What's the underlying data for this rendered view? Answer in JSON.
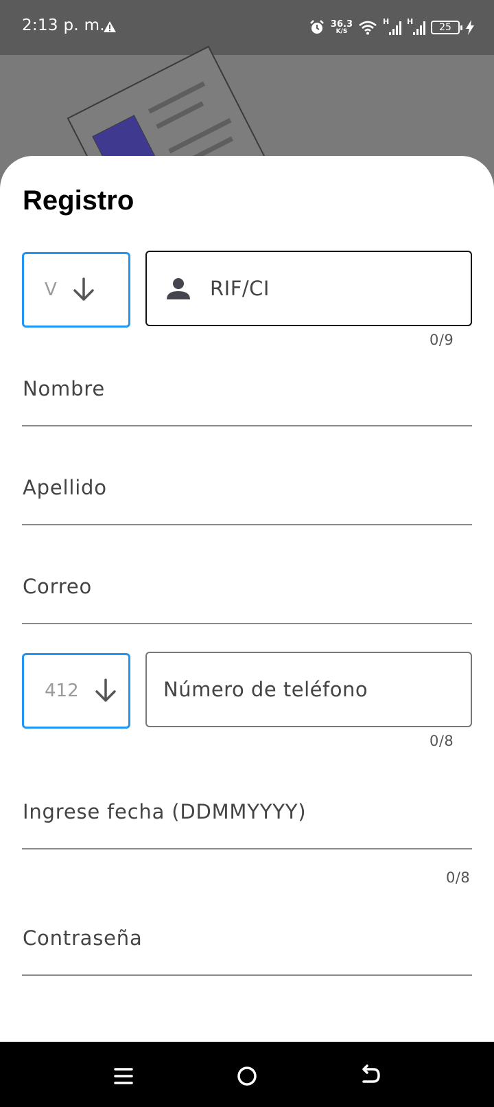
{
  "status_bar": {
    "time": "2:13 p. m.",
    "network_speed": "36.3",
    "network_speed_unit": "K/S",
    "signal_1_type": "H",
    "signal_2_type": "H",
    "battery_level": "25",
    "icons": [
      "warning-icon",
      "alarm-icon",
      "wifi-icon",
      "signal-icon",
      "signal-icon",
      "battery-icon",
      "charging-icon"
    ]
  },
  "form": {
    "title": "Registro",
    "id_type": {
      "value": "V",
      "icon": "arrow-down-icon"
    },
    "rif_ci": {
      "placeholder": "RIF/CI",
      "counter": "0/9",
      "icon": "person-icon"
    },
    "nombre": {
      "placeholder": "Nombre"
    },
    "apellido": {
      "placeholder": "Apellido"
    },
    "correo": {
      "placeholder": "Correo"
    },
    "phone_prefix": {
      "value": "412",
      "icon": "arrow-down-icon"
    },
    "phone": {
      "placeholder": "Número de teléfono",
      "counter": "0/8"
    },
    "fecha": {
      "placeholder": "Ingrese fecha (DDMMYYYY)",
      "counter": "0/8"
    },
    "password": {
      "placeholder": "Contraseña"
    }
  },
  "colors": {
    "accent": "#2196f3",
    "status_bar": "#5b5b5b",
    "scrim": "#7a7a7a",
    "nav_bar": "#000000"
  }
}
